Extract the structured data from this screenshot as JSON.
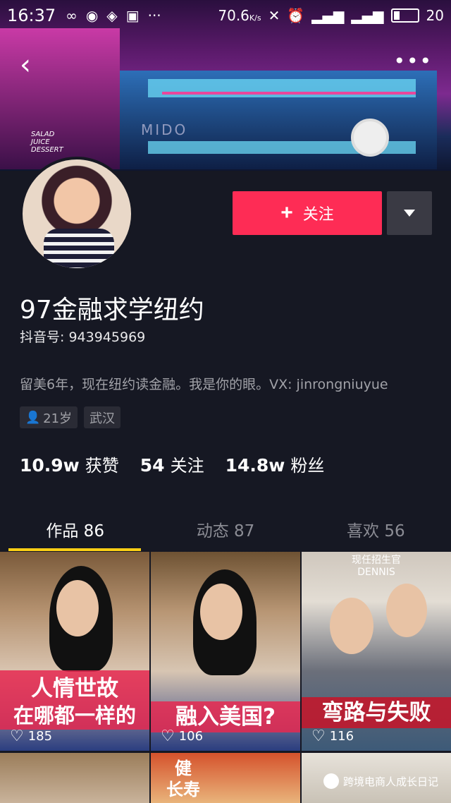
{
  "status_bar": {
    "time": "16:37",
    "network_speed": "70.6",
    "network_unit": "K/s",
    "signal_label": "4G LTE",
    "battery": "20"
  },
  "profile": {
    "name": "97金融求学纽约",
    "douyin_id_label": "抖音号:",
    "douyin_id": "943945969",
    "bio": "留美6年，现在纽约读金融。我是你的眼。VX: jinrongniuyue",
    "age_tag": "21岁",
    "city_tag": "武汉",
    "follow_label": "关注"
  },
  "stats": [
    {
      "value": "10.9w",
      "label": "获赞"
    },
    {
      "value": "54",
      "label": "关注"
    },
    {
      "value": "14.8w",
      "label": "粉丝"
    }
  ],
  "tabs": [
    {
      "label": "作品 86",
      "active": true
    },
    {
      "label": "动态 87",
      "active": false
    },
    {
      "label": "喜欢 56",
      "active": false
    }
  ],
  "videos": [
    {
      "caption_line1": "人情世故",
      "caption_line2": "在哪都一样的",
      "likes": "185"
    },
    {
      "caption_line1": "融入美国?",
      "likes": "106"
    },
    {
      "top_text_1": "现任招生官",
      "top_text_2": "DENNIS",
      "caption_line1": "弯路与失败",
      "likes": "116"
    },
    {},
    {
      "caption_line1": "健",
      "caption_line2": "长寿"
    },
    {}
  ],
  "cover": {
    "sign_lines": [
      "SALAD",
      "JUICE",
      "DESSERT"
    ],
    "shop_name": "MIDO"
  },
  "watermark": "跨境电商人成长日记",
  "colors": {
    "accent": "#fe2c55",
    "tab_indicator": "#face15",
    "background": "#161823"
  }
}
